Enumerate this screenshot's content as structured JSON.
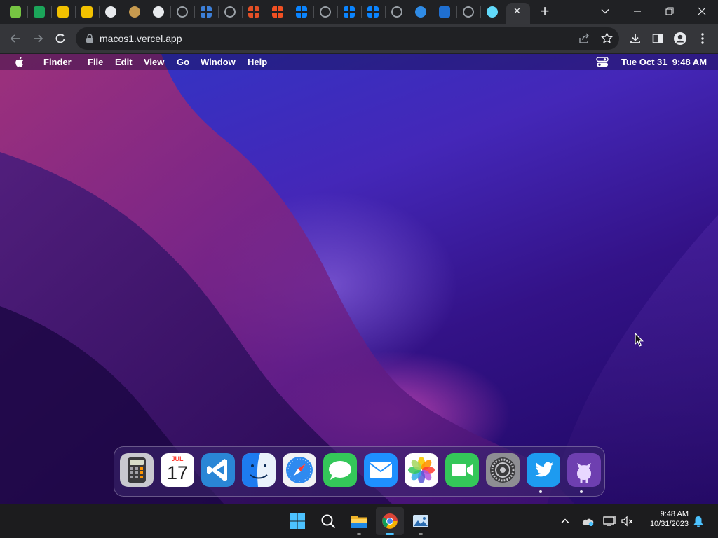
{
  "browser": {
    "address": "macos1.vercel.app",
    "close_tab_glyph": "✕",
    "new_tab_glyph": "+",
    "tab_search_glyph": "⌄",
    "minimize_glyph": "—",
    "restore_glyph": "❐",
    "close_glyph": "✕",
    "tabs": [
      {
        "icon": "anime-site-icon",
        "color": "#76c442"
      },
      {
        "icon": "spreadsheet-icon",
        "color": "#1ba55a"
      },
      {
        "icon": "yellow-site-icon",
        "color": "#f2c100"
      },
      {
        "icon": "yellow-site-icon",
        "color": "#f2c100"
      },
      {
        "icon": "emblem-icon",
        "color": "#e8eaed"
      },
      {
        "icon": "doge-icon",
        "color": "#c79a4f"
      },
      {
        "icon": "github-icon",
        "color": "#e8eaed"
      },
      {
        "icon": "globe-icon",
        "color": "#9aa0a6"
      },
      {
        "icon": "windows-xp-icon",
        "color": "#3c7fd8"
      },
      {
        "icon": "globe-icon",
        "color": "#9aa0a6"
      },
      {
        "icon": "windows-logo-icon",
        "color": "#e34f26"
      },
      {
        "icon": "windows-logo-icon",
        "color": "#f25022"
      },
      {
        "icon": "windows-11-icon",
        "color": "#0a84ff"
      },
      {
        "icon": "globe-icon",
        "color": "#9aa0a6"
      },
      {
        "icon": "windows-11-icon",
        "color": "#0a84ff"
      },
      {
        "icon": "windows-11-icon",
        "color": "#0a84ff"
      },
      {
        "icon": "globe-icon",
        "color": "#9aa0a6"
      },
      {
        "icon": "blue-circle-icon",
        "color": "#2f8be6"
      },
      {
        "icon": "dark-app-icon",
        "color": "#1f6fd1"
      },
      {
        "icon": "globe-icon",
        "color": "#9aa0a6"
      },
      {
        "icon": "react-icon",
        "color": "#61dafb"
      }
    ]
  },
  "macos": {
    "menubar": {
      "app": "Finder",
      "items": [
        "File",
        "Edit",
        "View",
        "Go",
        "Window",
        "Help"
      ],
      "datetime": "Tue Oct 31  9:48 AM"
    },
    "dock": [
      {
        "name": "Calculator",
        "icon": "calculator-icon"
      },
      {
        "name": "Calendar",
        "icon": "calendar-icon",
        "month": "JUL",
        "day": "17"
      },
      {
        "name": "Visual Studio Code",
        "icon": "vscode-icon"
      },
      {
        "name": "Finder",
        "icon": "finder-icon"
      },
      {
        "name": "Safari",
        "icon": "safari-icon"
      },
      {
        "name": "Messages",
        "icon": "messages-icon"
      },
      {
        "name": "Mail",
        "icon": "mail-icon"
      },
      {
        "name": "Photos",
        "icon": "photos-icon"
      },
      {
        "name": "FaceTime",
        "icon": "facetime-icon"
      },
      {
        "name": "System Settings",
        "icon": "settings-icon"
      },
      {
        "name": "Twitter",
        "icon": "twitter-icon",
        "running": true
      },
      {
        "name": "GitHub",
        "icon": "github-icon",
        "running": true
      }
    ]
  },
  "windows": {
    "taskbar_apps": [
      {
        "name": "Start",
        "icon": "windows-start-icon"
      },
      {
        "name": "Search",
        "icon": "search-icon"
      },
      {
        "name": "File Explorer",
        "icon": "folder-icon",
        "running": true
      },
      {
        "name": "Google Chrome",
        "icon": "chrome-icon",
        "running": true,
        "active": true
      },
      {
        "name": "Photos",
        "icon": "photos-app-icon",
        "running": true
      }
    ],
    "time": "9:48 AM",
    "date": "10/31/2023"
  }
}
